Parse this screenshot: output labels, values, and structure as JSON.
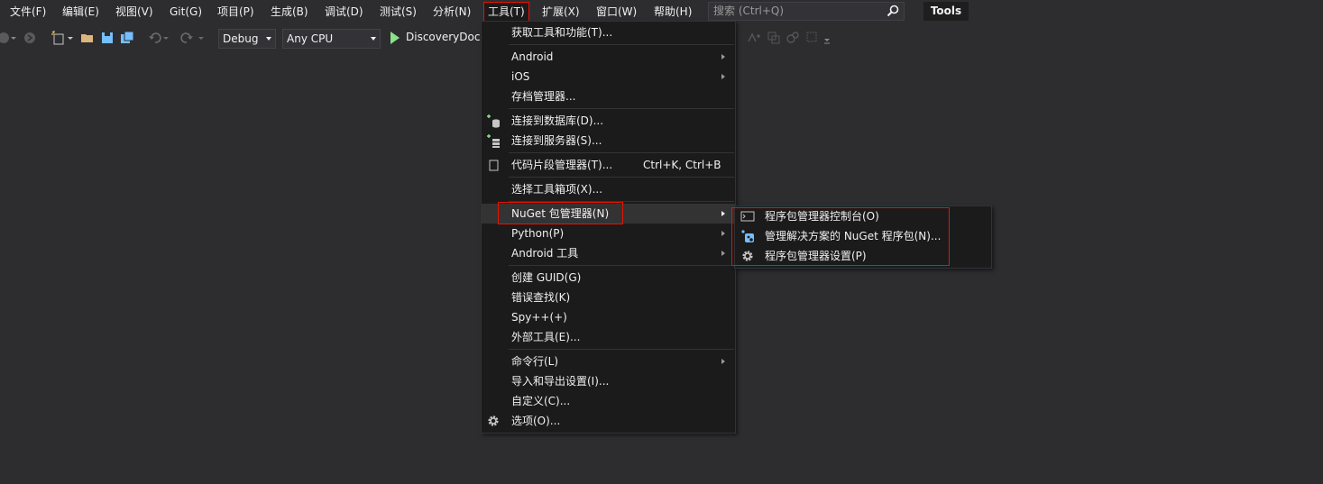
{
  "menubar": {
    "items": [
      "文件(F)",
      "编辑(E)",
      "视图(V)",
      "Git(G)",
      "项目(P)",
      "生成(B)",
      "调试(D)",
      "测试(S)",
      "分析(N)",
      "工具(T)",
      "扩展(X)",
      "窗口(W)",
      "帮助(H)"
    ],
    "search_placeholder": "搜索 (Ctrl+Q)",
    "badge": "Tools"
  },
  "toolbar": {
    "config": "Debug",
    "platform": "Any CPU",
    "run_target": "DiscoveryDock"
  },
  "tools_menu": {
    "items": [
      {
        "label": "获取工具和功能(T)..."
      },
      {
        "label": "Android",
        "submenu": true
      },
      {
        "label": "iOS",
        "submenu": true
      },
      {
        "label": "存档管理器..."
      },
      {
        "label": "连接到数据库(D)...",
        "icon": "database-connect-icon"
      },
      {
        "label": "连接到服务器(S)...",
        "icon": "server-connect-icon"
      },
      {
        "label": "代码片段管理器(T)...",
        "shortcut": "Ctrl+K, Ctrl+B",
        "icon": "snippet-icon"
      },
      {
        "label": "选择工具箱项(X)..."
      },
      {
        "label": "NuGet 包管理器(N)",
        "submenu": true
      },
      {
        "label": "Python(P)",
        "submenu": true
      },
      {
        "label": "Android 工具",
        "submenu": true
      },
      {
        "label": "创建 GUID(G)"
      },
      {
        "label": "错误查找(K)"
      },
      {
        "label": "Spy++(+)"
      },
      {
        "label": "外部工具(E)..."
      },
      {
        "label": "命令行(L)",
        "submenu": true
      },
      {
        "label": "导入和导出设置(I)..."
      },
      {
        "label": "自定义(C)..."
      },
      {
        "label": "选项(O)...",
        "icon": "gear-icon"
      }
    ]
  },
  "nuget_submenu": {
    "items": [
      {
        "label": "程序包管理器控制台(O)",
        "icon": "console-icon"
      },
      {
        "label": "管理解决方案的 NuGet 程序包(N)...",
        "icon": "nuget-package-icon"
      },
      {
        "label": "程序包管理器设置(P)",
        "icon": "gear-icon"
      }
    ]
  },
  "colors": {
    "background": "#2d2d30",
    "menu_bg": "#1b1b1c",
    "highlight_border": "#e51400",
    "run_green": "#8ae28a"
  }
}
